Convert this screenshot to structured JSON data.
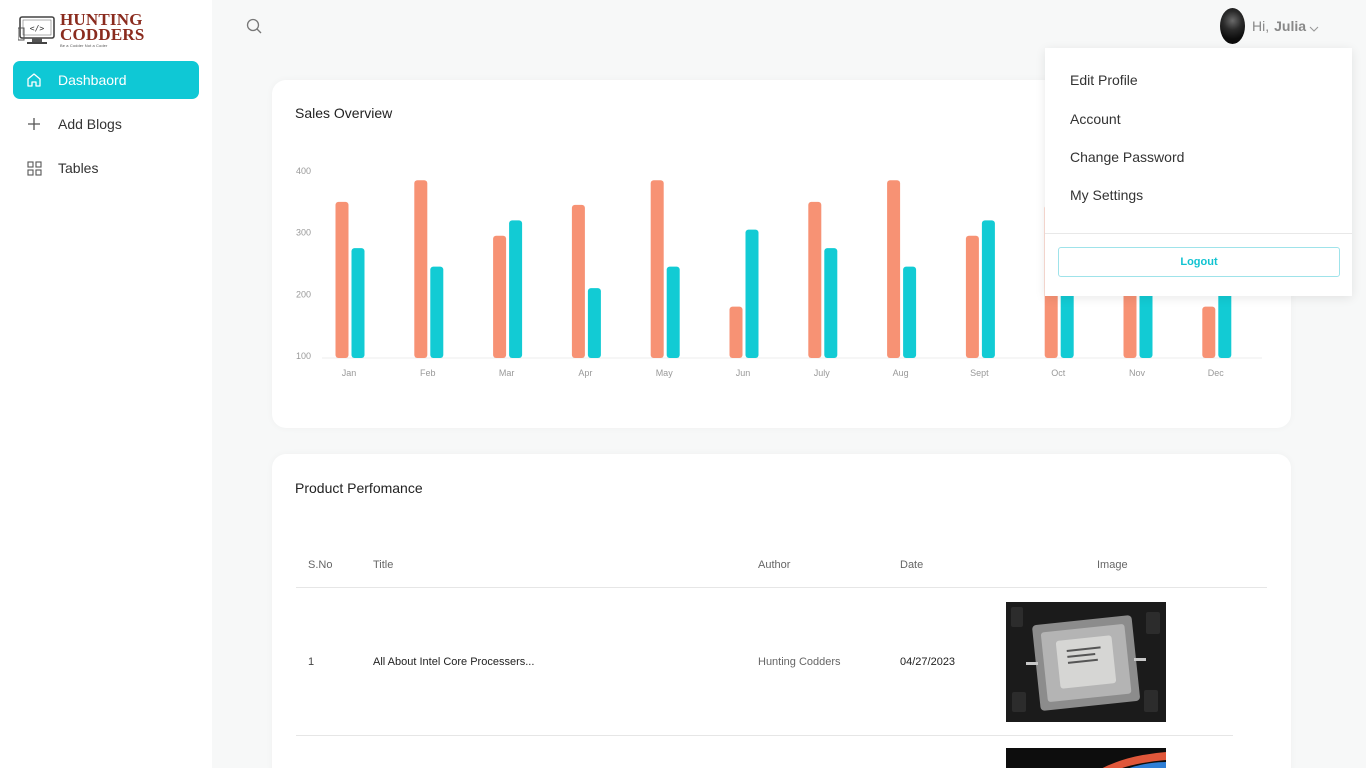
{
  "brand": {
    "line1": "HUNTING",
    "line2": "CODDERS",
    "tagline": "Be a Codder Not a Coder"
  },
  "sidebar": {
    "items": [
      {
        "label": "Dashbaord",
        "icon": "home-icon",
        "active": true
      },
      {
        "label": "Add Blogs",
        "icon": "plus-icon",
        "active": false
      },
      {
        "label": "Tables",
        "icon": "grid-icon",
        "active": false
      }
    ]
  },
  "header": {
    "search_icon": "search-icon",
    "greeting": "Hi,",
    "username": "Julia"
  },
  "user_menu": {
    "items": [
      "Edit Profile",
      "Account",
      "Change Password",
      "My Settings"
    ],
    "logout_label": "Logout"
  },
  "sales": {
    "title": "Sales Overview"
  },
  "chart_data": {
    "type": "bar",
    "categories": [
      "Jan",
      "Feb",
      "Mar",
      "Apr",
      "May",
      "Jun",
      "July",
      "Aug",
      "Sept",
      "Oct",
      "Nov",
      "Dec"
    ],
    "series": [
      {
        "values": [
          350,
          385,
          295,
          345,
          385,
          180,
          350,
          385,
          295,
          345,
          270,
          180
        ],
        "color": "#f79274"
      },
      {
        "values": [
          275,
          245,
          320,
          210,
          245,
          305,
          275,
          245,
          320,
          300,
          310,
          280
        ],
        "color": "#12cbd4"
      }
    ],
    "yticks": [
      400,
      300,
      200,
      100
    ],
    "ylim": [
      100,
      400
    ],
    "grid": false
  },
  "products": {
    "title": "Product Perfomance",
    "columns": [
      "S.No",
      "Title",
      "Author",
      "Date",
      "Image"
    ],
    "rows": [
      {
        "sno": "1",
        "title": "All About Intel Core Processers...",
        "author": "Hunting Codders",
        "date": "04/27/2023"
      }
    ]
  },
  "colors": {
    "accent": "#0fc8d5",
    "bar_primary": "#f79274",
    "bar_secondary": "#12cbd4",
    "brand": "#8a2b1e"
  }
}
